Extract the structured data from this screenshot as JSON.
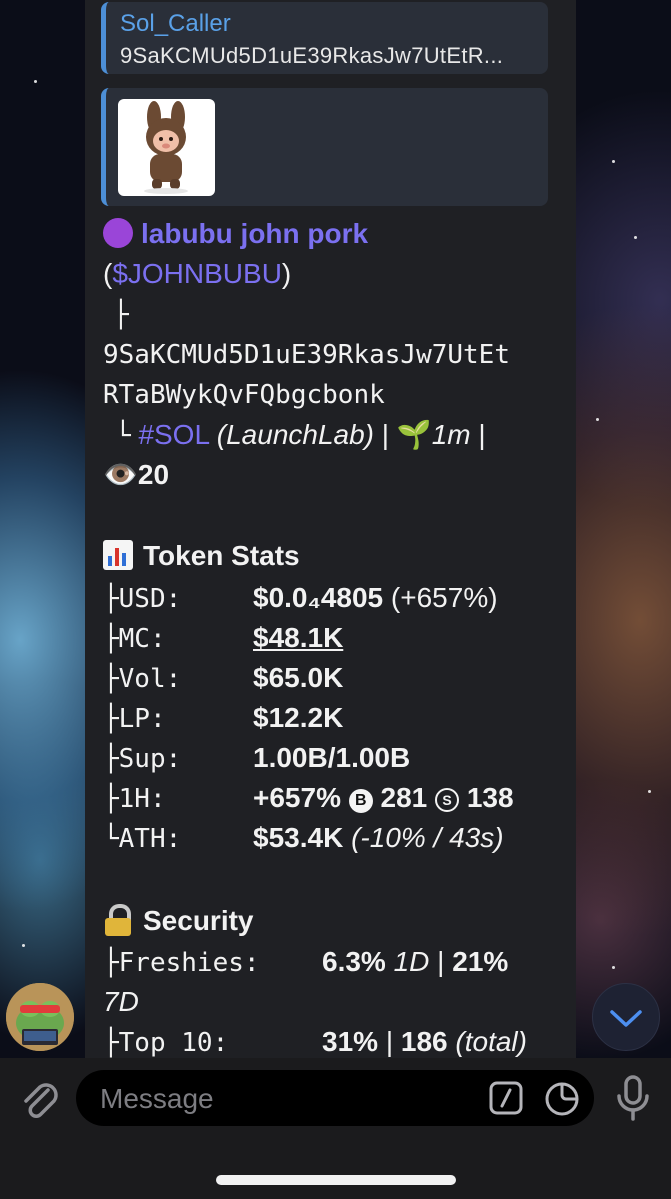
{
  "reply": {
    "sender": "Sol_Caller",
    "preview_text": "9SaKCMUd5D1uE39RkasJw7UtEtR..."
  },
  "token": {
    "name": "labubu john pork",
    "ticker_open": "(",
    "ticker": "$JOHNBUBU",
    "ticker_close": ")",
    "tree_branch": "├",
    "address_line1": "9SaKCMUd5D1uE39RkasJw7UtEt",
    "address_line2": "RTaBWykQvFQbgcbonk",
    "tree_end": "└",
    "chain_tag": "#SOL",
    "launchpad": "(LaunchLab)",
    "separator": "|",
    "age": "1m",
    "views": "20"
  },
  "token_stats": {
    "heading": "Token Stats",
    "rows": [
      {
        "key": "├USD:",
        "value": "$0.0₄4805",
        "extra": "(+657%)"
      },
      {
        "key": "├MC:",
        "value": "$48.1K",
        "extra": ""
      },
      {
        "key": "├Vol:",
        "value": "$65.0K",
        "extra": ""
      },
      {
        "key": "├LP:",
        "value": "$12.2K",
        "extra": ""
      },
      {
        "key": "├Sup:",
        "value": "1.00B/1.00B",
        "extra": ""
      },
      {
        "key": "├1H:",
        "value": "+657%",
        "extra": ""
      },
      {
        "key": "└ATH:",
        "value": "$53.4K",
        "extra": "(-10% / 43s)"
      }
    ],
    "buys_badge": "B",
    "buys": "281",
    "sells_badge": "S",
    "sells": "138"
  },
  "security": {
    "heading": "Security",
    "freshies_key": "├Freshies:",
    "freshies_1d": "6.3%",
    "freshies_1d_label": "1D",
    "freshies_7d": "21%",
    "freshies_7d_label": "7D",
    "top10_key": "├Top 10:",
    "top10_pct": "31%",
    "top10_count": "186",
    "top10_label": "(total)"
  },
  "composer": {
    "placeholder": "Message"
  },
  "icons": {
    "attach": "paperclip-icon",
    "commands": "slash-command-icon",
    "sticker": "sticker-icon",
    "mic": "microphone-icon",
    "scroll": "chevron-down-icon"
  },
  "colors": {
    "accent": "#7b70f0",
    "reply_accent": "#4d8fd6",
    "bubble": "#1f2024"
  }
}
